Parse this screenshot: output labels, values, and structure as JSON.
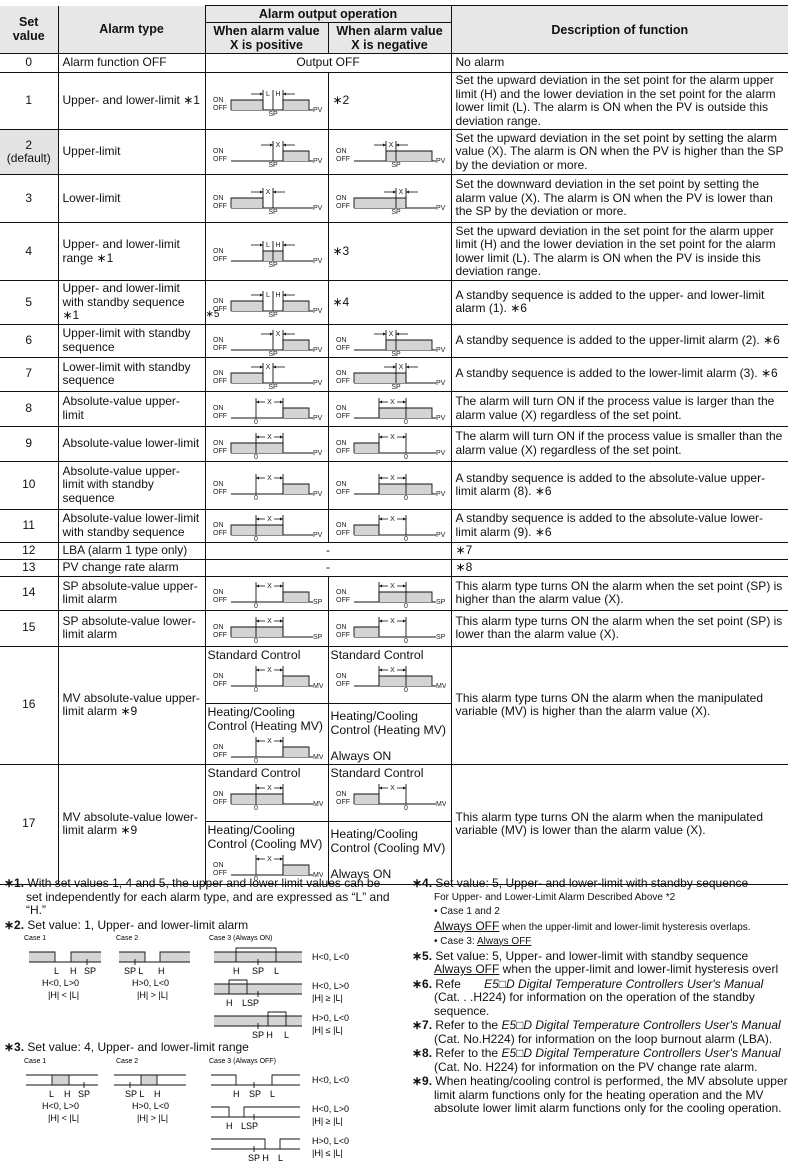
{
  "header": {
    "set_value": "Set value",
    "alarm_type": "Alarm type",
    "alarm_output_operation": "Alarm output operation",
    "positive": "When alarm value X is positive",
    "negative": "When alarm value X is negative",
    "description": "Description of function"
  },
  "labels": {
    "on": "ON",
    "off": "OFF",
    "sp": "SP",
    "pv": "PV",
    "mv": "MV",
    "zero": "0",
    "x": "X",
    "l": "L",
    "h": "H",
    "dash": "-"
  },
  "rows": [
    {
      "set": "0",
      "type": "Alarm function OFF",
      "output": "Output OFF",
      "desc": "No alarm"
    },
    {
      "set": "1",
      "type": "Upper- and lower-limit ∗1",
      "pos": "ul",
      "neg_ref": "∗2",
      "desc": "Set the upward deviation in the set point for the alarm upper limit (H) and the lower deviation in the set point for the alarm lower limit (L). The alarm is ON when the PV is outside this deviation range."
    },
    {
      "set": "2",
      "set_note": "(default)",
      "type": "Upper-limit",
      "pos": "upper_pos",
      "neg": "upper_neg",
      "desc": "Set the upward deviation in the set point by setting the alarm value (X). The alarm is ON when the PV is higher than the SP by the deviation or more."
    },
    {
      "set": "3",
      "type": "Lower-limit",
      "pos": "lower_pos",
      "neg": "lower_neg",
      "desc": "Set the downward deviation in the set point by setting the alarm value (X). The alarm is ON when the PV is lower than the SP by the deviation or more."
    },
    {
      "set": "4",
      "type": "Upper- and lower-limit range ∗1",
      "pos": "range",
      "neg_ref": "∗3",
      "desc": "Set the upward deviation in the set point for the alarm upper limit (H) and the lower deviation in the set point for the alarm lower limit (L). The alarm is ON when the PV is inside this deviation range."
    },
    {
      "set": "5",
      "type": "Upper- and lower-limit with standby sequence ∗1",
      "pos": "ul",
      "pos_ref": "∗5",
      "neg_ref": "∗4",
      "desc": "A standby sequence is added to the upper- and lower-limit alarm (1). ∗6"
    },
    {
      "set": "6",
      "type": "Upper-limit with standby sequence",
      "pos": "upper_pos",
      "neg": "upper_neg",
      "desc": "A standby sequence is added to the upper-limit alarm (2). ∗6"
    },
    {
      "set": "7",
      "type": "Lower-limit with standby sequence",
      "pos": "lower_pos",
      "neg": "lower_neg",
      "desc": "A standby sequence is added to the lower-limit alarm (3). ∗6"
    },
    {
      "set": "8",
      "type": "Absolute-value upper-limit",
      "pos": "abs_upper_pos",
      "neg": "abs_upper_neg",
      "axis": "PV",
      "desc": "The alarm will turn ON if the process value is larger than the alarm value (X) regardless of the set point."
    },
    {
      "set": "9",
      "type": "Absolute-value lower-limit",
      "pos": "abs_lower_pos",
      "neg": "abs_lower_neg",
      "axis": "PV",
      "desc": "The alarm will turn ON if the process value is smaller than the alarm value (X) regardless of the set point."
    },
    {
      "set": "10",
      "type": "Absolute-value upper-limit with standby sequence",
      "pos": "abs_upper_pos",
      "neg": "abs_upper_neg",
      "axis": "PV",
      "desc": "A standby sequence is added to the absolute-value upper-limit alarm (8). ∗6"
    },
    {
      "set": "11",
      "type": "Absolute-value lower-limit with standby sequence",
      "pos": "abs_lower_pos",
      "neg": "abs_lower_neg",
      "axis": "PV",
      "desc": "A standby sequence is added to the absolute-value lower-limit alarm (9). ∗6"
    },
    {
      "set": "12",
      "type": "LBA (alarm 1 type only)",
      "output": "-",
      "desc": "∗7"
    },
    {
      "set": "13",
      "type": "PV change rate alarm",
      "output": "-",
      "desc": "∗8"
    },
    {
      "set": "14",
      "type": "SP absolute-value upper-limit alarm",
      "pos": "abs_upper_pos",
      "neg": "abs_upper_neg",
      "axis": "SP",
      "desc": "This alarm type turns ON the alarm when the set point (SP) is higher than the alarm value (X)."
    },
    {
      "set": "15",
      "type": "SP absolute-value lower-limit alarm",
      "pos": "abs_lower_pos",
      "neg": "abs_lower_neg",
      "axis": "SP",
      "desc": "This alarm type turns ON the alarm when the set point (SP) is lower than the alarm value (X)."
    },
    {
      "set": "16",
      "type": "MV absolute-value upper-limit alarm ∗9",
      "std_pos_title": "Standard Control",
      "std_neg_title": "Standard Control",
      "std_pos": "abs_upper_pos",
      "std_neg": "abs_upper_neg",
      "hc_pos_title": "Heating/Cooling Control (Heating MV)",
      "hc_neg_title": "Heating/Cooling Control (Heating MV)",
      "hc_pos": "abs_upper_pos",
      "hc_neg_text": "Always ON",
      "axis": "MV",
      "desc": "This alarm type turns ON the alarm when the manipulated variable (MV) is higher than the alarm value (X)."
    },
    {
      "set": "17",
      "type": "MV absolute-value lower-limit alarm ∗9",
      "std_pos_title": "Standard Control",
      "std_neg_title": "Standard Control",
      "std_pos": "abs_lower_pos",
      "std_neg": "abs_lower_neg",
      "hc_pos_title": "Heating/Cooling Control (Cooling MV)",
      "hc_neg_title": "Heating/Cooling Control (Cooling MV)",
      "hc_pos": "abs_upper_pos",
      "hc_neg_text": "Always ON",
      "axis": "MV",
      "desc": "This alarm type turns ON the alarm when the manipulated variable (MV) is lower than the alarm value (X)."
    }
  ],
  "notes": {
    "n1": {
      "mark": "∗1.",
      "text": "With set values 1, 4 and 5, the upper and lower limit values can be set independently for each alarm type, and are expressed as “L” and “H.”"
    },
    "n2": {
      "mark": "∗2.",
      "text": "Set value: 1, Upper- and lower-limit alarm",
      "case1": "Case 1",
      "case2": "Case 2",
      "case3": "Case 3 (Always ON)",
      "c1_cond1": "H<0, L>0",
      "c1_cond2": "|H| < |L|",
      "c2_cond1": "H>0, L<0",
      "c2_cond2": "|H| > |L|",
      "c3a": "H<0, L<0",
      "c3b1": "H<0, L>0",
      "c3b2": "|H| ≥ |L|",
      "c3c1": "H>0, L<0",
      "c3c2": "|H| ≤ |L|"
    },
    "n3": {
      "mark": "∗3.",
      "text": "Set value: 4, Upper- and lower-limit range",
      "case1": "Case 1",
      "case2": "Case 2",
      "case3": "Case 3 (Always OFF)",
      "c1_cond1": "H<0, L>0",
      "c1_cond2": "|H| < |L|",
      "c2_cond1": "H>0, L<0",
      "c2_cond2": "|H| > |L|",
      "c3a": "H<0, L<0",
      "c3b1": "H<0, L>0",
      "c3b2": "|H| ≥ |L|",
      "c3c1": "H>0, L<0",
      "c3c2": "|H| ≤ |L|"
    },
    "n4": {
      "mark": "∗4.",
      "text": "Set value: 5, Upper- and lower-limit with standby sequence",
      "line1": "For Upper- and Lower-Limit Alarm Described Above *2",
      "line2": "• Case 1 and 2",
      "line3_u": "Always OFF",
      "line3": " when the upper-limit and lower-limit hysteresis overlaps.",
      "line4": "• Case 3: ",
      "line4_u": "Always OFF"
    },
    "n5": {
      "mark": "∗5.",
      "text": "Set value: 5, Upper- and lower-limit with standby sequence",
      "line_u": "Always OFF",
      "line": " when the upper-limit and lower-limit hysteresis overl"
    },
    "n6": {
      "mark": "∗6.",
      "pre": "Refe",
      "manual": "E5□D Digital Temperature Controllers User's Manual",
      "post": "(Cat. .  .H224) for information on the operation of the standby sequence."
    },
    "n7": {
      "mark": "∗7.",
      "pre": "Refer to the ",
      "manual": "E5□D Digital Temperature Controllers User's Manual",
      "post": "(Cat. No.H224) for information on the loop burnout alarm (LBA)."
    },
    "n8": {
      "mark": "∗8.",
      "pre": "Refer to the ",
      "manual": "E5□D Digital Temperature Controllers User's Manual",
      "post": "(Cat. No. H224) for information on the PV change rate alarm."
    },
    "n9": {
      "mark": "∗9.",
      "text": "When heating/cooling control is performed, the MV absolute upper limit alarm functions only for the heating operation and the MV absolute lower limit alarm functions only for the cooling operation."
    }
  }
}
